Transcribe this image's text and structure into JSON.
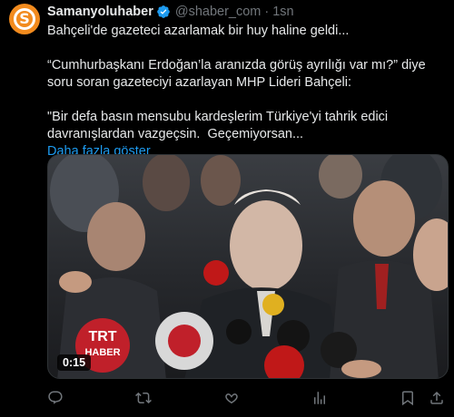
{
  "author": {
    "name": "Samanyoluhaber",
    "handle": "@shaber_com",
    "separator": "·",
    "time": "1sn",
    "avatar_letter": "S",
    "avatar_color": "#f28b1e",
    "verified": true
  },
  "tweet": {
    "lines": [
      "Bahçeli'de gazeteci azarlamak bir huy haline geldi...",
      "",
      "“Cumhurbaşkanı Erdoğan’la aranızda görüş ayrılığı var mı?” diye soru soran gazeteciyi azarlayan MHP Lideri Bahçeli:",
      "",
      "\"Bir defa basın mensubu kardeşlerim Türkiye'yi tahrik edici davranışlardan vazgeçsin.  Geçemiyorsan..."
    ],
    "show_more": "Daha fazla göster"
  },
  "media": {
    "type": "video",
    "duration": "0:15",
    "microphone_labels": [
      "TRT",
      "HABER"
    ]
  },
  "actions": {
    "icons": [
      "reply-icon",
      "retweet-icon",
      "like-icon",
      "views-icon",
      "bookmark-icon",
      "share-icon"
    ]
  },
  "colors": {
    "background": "#000000",
    "text": "#e7e9ea",
    "muted": "#71767b",
    "link": "#1d9bf0",
    "verified": "#1d9bf0"
  }
}
